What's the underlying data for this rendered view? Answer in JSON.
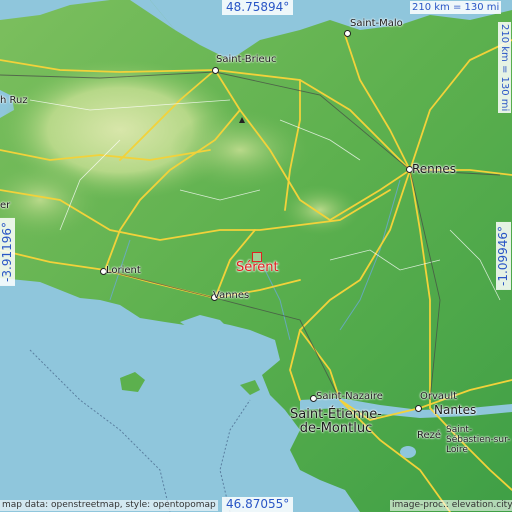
{
  "map": {
    "marker": {
      "label": "Sérent",
      "color": "#e02020"
    },
    "coords": {
      "top": "48.75894°",
      "bottom": "46.87055°",
      "left": "-3.91196°",
      "right": "-1.09946°"
    },
    "scale": {
      "horizontal": "210 km = 130 mi",
      "vertical": "210 km = 130 mi"
    },
    "credits": {
      "left": "map data: openstreetmap, style: opentopomap",
      "right": "image-proc.: elevation.city"
    },
    "places": {
      "saint_malo": "Saint-Malo",
      "saint_brieuc": "Saint-Brieuc",
      "rennes": "Rennes",
      "lorient": "Lorient",
      "vannes": "Vannes",
      "saint_nazaire": "Saint-Nazaire",
      "saint_etienne": "Saint-Étienne-de-Montluc",
      "orvault": "Orvault",
      "nantes": "Nantes",
      "reze": "Rezé",
      "saint_sebastien": "Saint-Sébastien-sur-Loire",
      "partial_ruz": "h Ruz",
      "partial_er": "er"
    },
    "colors": {
      "water": "#8fc6dc",
      "lowland": "#47a84a",
      "upland": "#d2e4a4",
      "roads": "#f2d23a",
      "marker": "#e02020",
      "coord_text": "#2a56c6"
    }
  }
}
